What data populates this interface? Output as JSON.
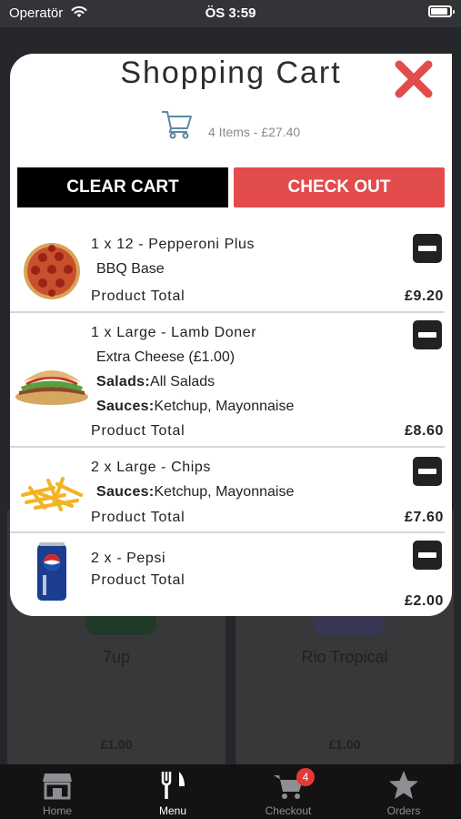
{
  "status_bar": {
    "carrier": "Operatör",
    "time": "ÖS 3:59"
  },
  "background": {
    "products": [
      {
        "name": "7up",
        "price": "£1.00"
      },
      {
        "name": "Rio Tropical",
        "price": "£1.00"
      }
    ]
  },
  "modal": {
    "title": "Shopping Cart",
    "close_icon": "close-x-icon",
    "summary": "4 Items - £27.40",
    "clear_label": "CLEAR CART",
    "checkout_label": "CHECK OUT",
    "total_label": "Product Total",
    "items": [
      {
        "title": "1 x 12 - Pepperoni Plus",
        "lines": [
          {
            "label": "",
            "value": "BBQ Base"
          }
        ],
        "price": "£9.20",
        "image": "pepperoni-pizza-image"
      },
      {
        "title": "1 x Large - Lamb Doner",
        "lines": [
          {
            "label": "",
            "value": "Extra Cheese (£1.00)"
          },
          {
            "label": "Salads:",
            "value": "All Salads"
          },
          {
            "label": "Sauces:",
            "value": "Ketchup, Mayonnaise"
          }
        ],
        "price": "£8.60",
        "image": "doner-kebab-image"
      },
      {
        "title": "2 x Large - Chips",
        "lines": [
          {
            "label": "Sauces:",
            "value": "Ketchup, Mayonnaise"
          }
        ],
        "price": "£7.60",
        "image": "chips-image"
      },
      {
        "title": "2 x - Pepsi",
        "lines": [],
        "price": "£2.00",
        "image": "pepsi-can-image"
      }
    ]
  },
  "tab_bar": {
    "tabs": [
      {
        "label": "Home",
        "icon": "store-icon"
      },
      {
        "label": "Menu",
        "icon": "fork-knife-icon"
      },
      {
        "label": "Checkout",
        "icon": "cart-icon",
        "badge": "4"
      },
      {
        "label": "Orders",
        "icon": "star-icon"
      }
    ],
    "active": "Menu"
  },
  "colors": {
    "accent_red": "#e24c4b",
    "close_red": "#e24c4b",
    "badge_red": "#e53935",
    "tab_bar_bg": "#131313"
  }
}
